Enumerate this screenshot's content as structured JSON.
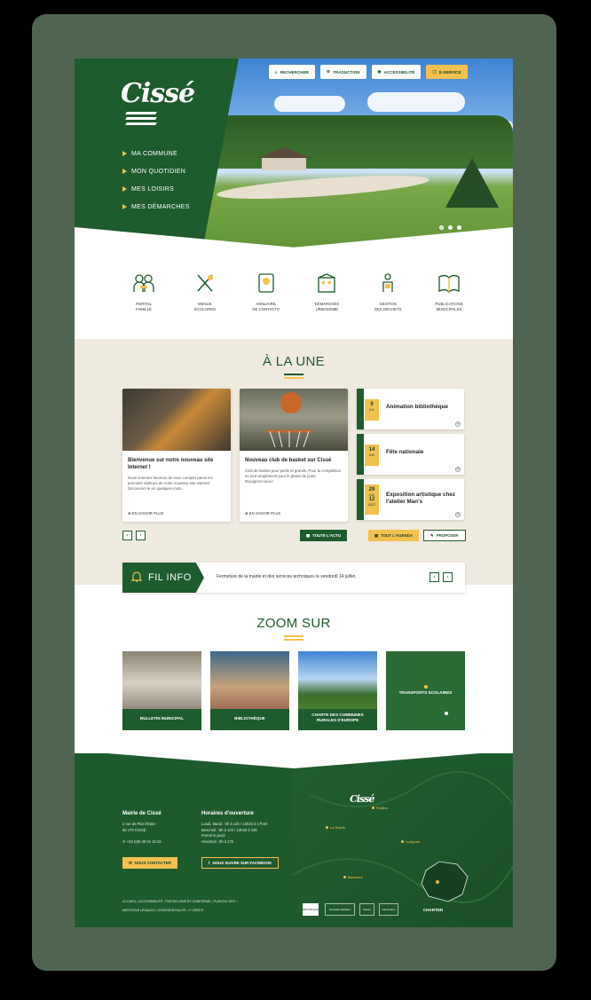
{
  "brand": {
    "logo": "Cissé",
    "accent": "#1e5b2d",
    "gold": "#f2c14e",
    "sand": "#efeadf"
  },
  "topbar": {
    "search": "RECHERCHER",
    "translate": "TRADUCTION",
    "accessibility": "ACCESSIBILITÉ",
    "eservice": "E-SERVICE"
  },
  "nav": [
    "MA COMMUNE",
    "MON QUOTIDIEN",
    "MES LOISIRS",
    "MES DÉMARCHES"
  ],
  "quick": [
    {
      "label": "PORTAIL\nFAMILLE",
      "icon": "family-icon"
    },
    {
      "label": "MENUS\nSCOLAIRES",
      "icon": "cutlery-icon"
    },
    {
      "label": "ANNUAIRE\nDE CONTACTS",
      "icon": "address-book-icon"
    },
    {
      "label": "DÉMARCHES\nURBANISME",
      "icon": "building-icon"
    },
    {
      "label": "GESTION\nDES DÉCHETS",
      "icon": "waste-icon"
    },
    {
      "label": "PUBLICATIONS\nMUNICIPALES",
      "icon": "book-icon"
    }
  ],
  "une": {
    "title": "À LA UNE",
    "cards": [
      {
        "title": "Bienvenue sur notre nouveau site Internet !",
        "desc": "Nous sommes heureux de vous compter parmi les premiers visiteurs de notre nouveau site Internet. Découvrez-le en quelques mots...",
        "more": "EN SAVOIR PLUS"
      },
      {
        "title": "Nouveau club de basket sur Cissé",
        "desc": "Club de basket pour petits et grands. Pour la compétition ou tout simplement pour le plaisir de jouer.\nRejoignez-nous !",
        "more": "EN SAVOIR PLUS"
      }
    ],
    "events": [
      {
        "day": "9",
        "month": "JUIL",
        "title": "Animation bibliothèque"
      },
      {
        "day": "14",
        "month": "JUIL",
        "title": "Fête nationale"
      },
      {
        "day": "29",
        "month": "JUIL",
        "day2": "12",
        "month2": "AOÛT",
        "title": "Exposition artistique chez l'atelier Man's"
      }
    ],
    "all_news": "TOUTE L'ACTU",
    "all_agenda": "TOUT L'AGENDA",
    "propose": "PROPOSER"
  },
  "fil_info": {
    "label": "FIL INFO",
    "text": "Fermeture de la mairie et des services techniques le vendredi 14 juillet."
  },
  "zoom": {
    "title": "ZOOM SUR",
    "tiles": [
      "BULLETIN MUNICIPAL",
      "BIBLIOTHÈQUE",
      "CHARTE DES COMMUNES\nRURALES D'EUROPE",
      "TRANSPORTS SCOLAIRES"
    ]
  },
  "footer": {
    "mairie_title": "Mairie de Cissé",
    "address": "2 rue de Plat d'Etain\n86 170 CISSÉ",
    "phone": "+33 (0)5 49 51 10 28",
    "hours_title": "Horaires d'ouverture",
    "hours": "Lundi, Mardi : 9h à 12h / 13h30 à 17h30\nMercredi : 9h à 12h / 13h30 à 16h\nFermé le jeudi\nVendredi : 9h à 17h",
    "contact_btn": "NOUS CONTACTER",
    "facebook_btn": "NOUS SUIVRE SUR FACEBOOK",
    "links1": "ACCUEIL  •  ACCESSIBILITÉ : PARTIELLEMENT CONFORME  •  PLAN DU SITE  •",
    "links2": "MENTIONS LÉGALES  •  CONFIDENTIALITÉ  •  © CREDIT",
    "cities": [
      "Poitiers",
      "La Roche",
      "Lusignan",
      "Bressuire"
    ],
    "partners": [
      "RÉPUBLIQUE",
      "Nouvelle-Aquitaine",
      "Vienne",
      "Haut-Poitou",
      "CHARTER"
    ]
  }
}
